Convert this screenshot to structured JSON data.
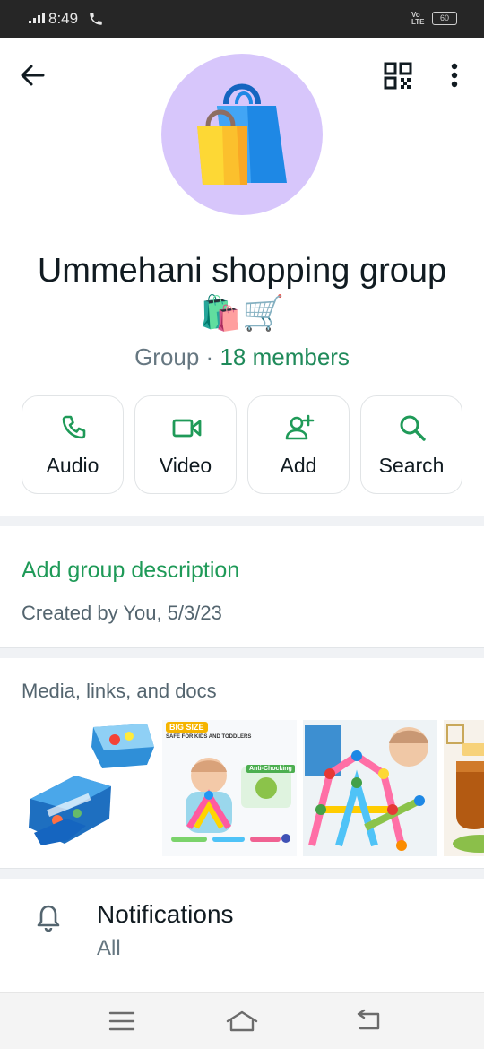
{
  "status_bar": {
    "time": "8:49",
    "network": "Vo LTE",
    "battery": "60"
  },
  "header": {
    "back_icon": "arrow-left-icon",
    "qr_icon": "qr-code-icon",
    "more_icon": "more-vertical-icon"
  },
  "group": {
    "avatar_icon": "shopping-bags-icon",
    "name": "Ummehani shopping group 🛍️🛒",
    "type": "Group",
    "separator": " · ",
    "members": "18 members"
  },
  "actions": [
    {
      "label": "Audio",
      "icon": "phone-icon"
    },
    {
      "label": "Video",
      "icon": "video-icon"
    },
    {
      "label": "Add",
      "icon": "add-person-icon"
    },
    {
      "label": "Search",
      "icon": "search-icon"
    }
  ],
  "description": {
    "link": "Add group description",
    "created": "Created by You, 5/3/23"
  },
  "media": {
    "title": "Media, links, and docs",
    "thumbs": [
      {
        "caption": ""
      },
      {
        "caption": "BIG SIZE",
        "sub": "SAFE FOR KIDS AND TODDLERS",
        "badge": "Anti-Chocking"
      },
      {
        "caption": ""
      },
      {
        "caption": ""
      }
    ]
  },
  "notifications": {
    "title": "Notifications",
    "value": "All"
  },
  "nav": {
    "menu_icon": "menu-icon",
    "home_icon": "home-icon",
    "back_icon": "back-icon"
  },
  "colors": {
    "accent": "#1f9a58",
    "avatar_bg": "#d7c6fb",
    "status_bar": "#262626"
  }
}
